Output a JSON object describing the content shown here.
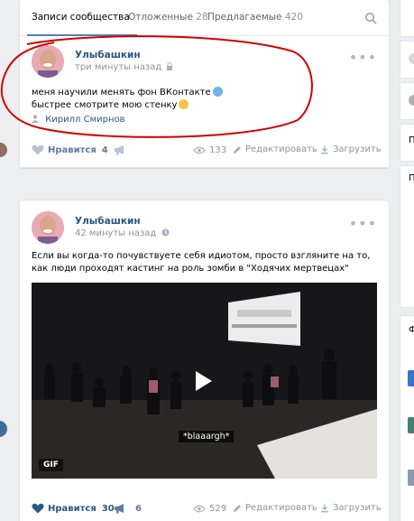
{
  "tabs": [
    {
      "label": "Записи сообщества",
      "count": ""
    },
    {
      "label": "Отложенные",
      "count": "28"
    },
    {
      "label": "Предлагаемые",
      "count": "420"
    }
  ],
  "posts": [
    {
      "author": "Улыбашкин",
      "time": "три минуты назад",
      "text_line1": "меня научили менять фон ВКонтакте",
      "text_line2": "быстрее смотрите мою стенку",
      "signer": "Кирилл Смирнов",
      "like_label": "Нравится",
      "like_count": "4",
      "views": "133",
      "edit_label": "Редактировать",
      "upload_label": "Загрузить"
    },
    {
      "author": "Улыбашкин",
      "time": "42 минуты назад",
      "text": "Если вы когда-то почувствуете себя идиотом, просто взгляните на то, как люди проходят кастинг на роль зомби в \"Ходячих мертвецах\"",
      "gif_label": "GIF",
      "caption": "*blaaargh*",
      "like_label": "Нравится",
      "like_count": "30",
      "share_count": "6",
      "views": "529",
      "edit_label": "Редактировать",
      "upload_label": "Загрузить"
    }
  ],
  "sidebar_letters": [
    "П",
    "П",
    "Ф"
  ],
  "colors": {
    "link": "#2a5885",
    "accent": "#5181b8",
    "annotation": "#d10000"
  }
}
